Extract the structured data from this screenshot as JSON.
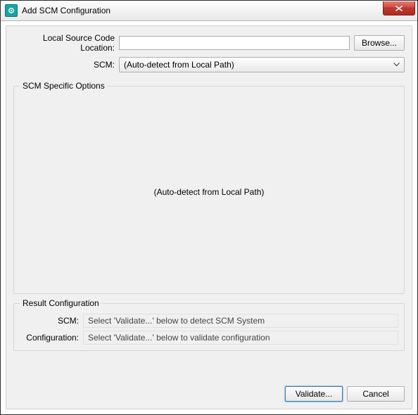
{
  "window": {
    "title": "Add SCM Configuration"
  },
  "labels": {
    "location": "Local Source Code Location:",
    "scm": "SCM:",
    "configuration": "Configuration:",
    "options_legend": "SCM Specific Options",
    "result_legend": "Result Configuration"
  },
  "fields": {
    "location_value": "",
    "scm_selected": "(Auto-detect from Local Path)"
  },
  "options": {
    "placeholder": "(Auto-detect from Local Path)"
  },
  "result": {
    "scm": "Select 'Validate...' below to detect SCM System",
    "configuration": "Select 'Validate...' below to validate configuration"
  },
  "buttons": {
    "browse": "Browse...",
    "validate": "Validate...",
    "cancel": "Cancel"
  }
}
